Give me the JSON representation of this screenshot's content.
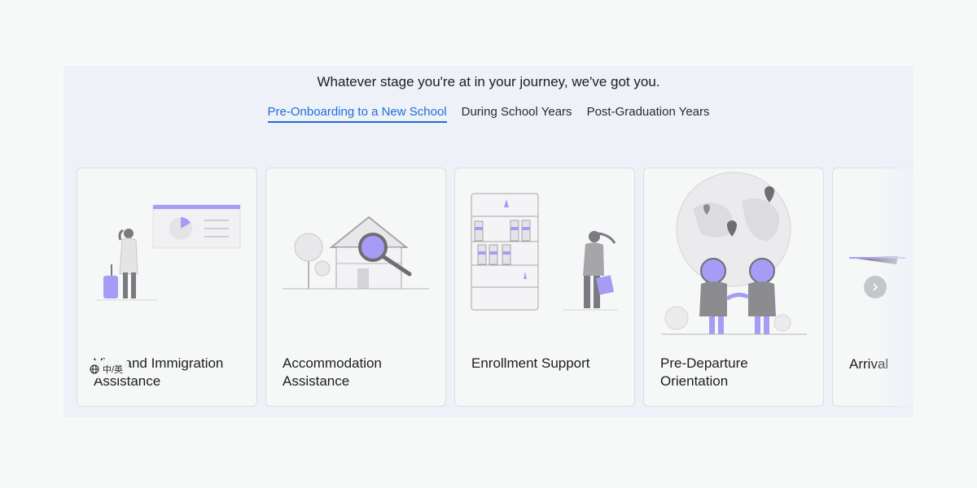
{
  "section": {
    "heading": "Whatever stage you're at in your journey, we've got you.",
    "tabs": [
      {
        "label": "Pre-Onboarding to a New School",
        "active": true
      },
      {
        "label": "During School Years",
        "active": false
      },
      {
        "label": "Post-Graduation Years",
        "active": false
      }
    ]
  },
  "cards": [
    {
      "title": "Visa and Immigration Assistance",
      "illustration": "traveler-with-luggage"
    },
    {
      "title": "Accommodation Assistance",
      "illustration": "house-with-magnifier"
    },
    {
      "title": "Enrollment Support",
      "illustration": "student-with-bookshelf"
    },
    {
      "title": "Pre-Departure Orientation",
      "illustration": "people-with-globe"
    },
    {
      "title": "Arrival",
      "illustration": "airplane"
    }
  ],
  "carousel": {
    "next_icon": "chevron-right-icon"
  },
  "language_toggle": {
    "label": "中/英",
    "icon": "globe-icon"
  },
  "colors": {
    "accent": "#1a6fd6",
    "illustration": "#a79cf5",
    "panel_bg": "#eff1f8"
  }
}
